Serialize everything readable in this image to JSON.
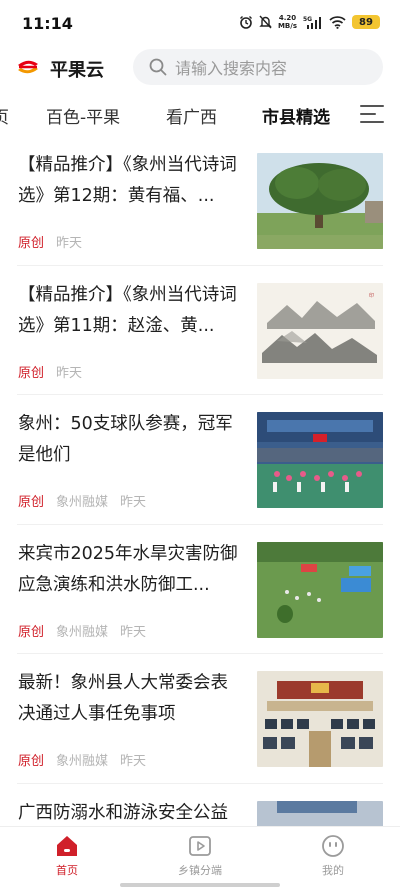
{
  "status_bar": {
    "time": "11:14",
    "net_speed_value": "4.20",
    "net_speed_unit": "MB/s",
    "network": "5G",
    "battery": "89"
  },
  "header": {
    "app_name": "平果云",
    "search_placeholder": "请输入搜索内容"
  },
  "tabs": [
    {
      "label": "页"
    },
    {
      "label": "百色-平果"
    },
    {
      "label": "看广西"
    },
    {
      "label": "市县精选",
      "active": true
    }
  ],
  "news": [
    {
      "title": "【精品推介】《象州当代诗词选》第12期：黄有福、...",
      "tag": "原创",
      "source": "",
      "time": "昨天",
      "thumb": "tree-photo"
    },
    {
      "title": "【精品推介】《象州当代诗词选》第11期：赵淦、黄...",
      "tag": "原创",
      "source": "",
      "time": "昨天",
      "thumb": "ink-landscape"
    },
    {
      "title": "象州：50支球队参赛，冠军是他们",
      "tag": "原创",
      "source": "象州融媒",
      "time": "昨天",
      "thumb": "gym-event"
    },
    {
      "title": "来宾市2025年水旱灾害防御应急演练和洪水防御工...",
      "tag": "原创",
      "source": "象州融媒",
      "time": "昨天",
      "thumb": "field-drill"
    },
    {
      "title": "最新！象州县人大常委会表决通过人事任免事项",
      "tag": "原创",
      "source": "象州融媒",
      "time": "昨天",
      "thumb": "meeting-hall"
    },
    {
      "title": "广西防溺水和游泳安全公益",
      "tag": "",
      "source": "",
      "time": "",
      "thumb": "partial"
    }
  ],
  "bottom_nav": [
    {
      "label": "首页",
      "icon": "home-icon",
      "active": true
    },
    {
      "label": "乡镇分端",
      "icon": "play-icon"
    },
    {
      "label": "我的",
      "icon": "face-icon"
    }
  ],
  "colors": {
    "accent": "#d0202a",
    "muted": "#b5b5b5"
  }
}
